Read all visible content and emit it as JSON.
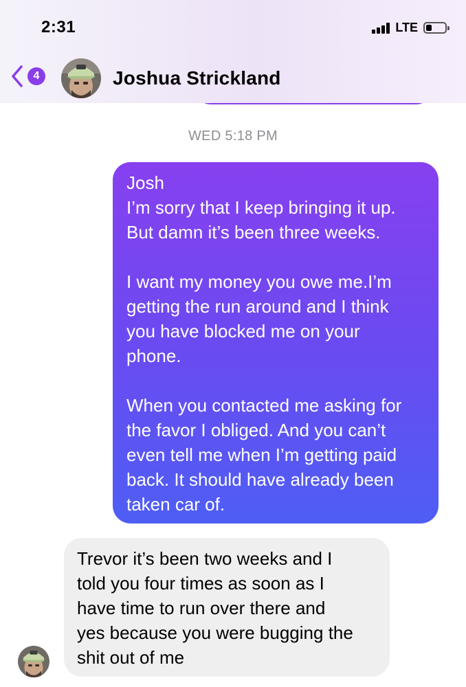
{
  "status_bar": {
    "time": "2:31",
    "network": "LTE",
    "battery_level": 0.3,
    "icons": [
      "signal-icon",
      "battery-icon"
    ]
  },
  "header": {
    "back_badge_count": "4",
    "contact_name": "Joshua Strickland",
    "icons": [
      "chevron-left-icon",
      "avatar"
    ]
  },
  "conversation": {
    "timestamp": "WED 5:18 PM",
    "sent_message": {
      "lines": [
        "Josh",
        "I’m sorry that I keep bringing it up.",
        "But damn it’s been three weeks.",
        "",
        "I want my money you owe me.I’m",
        "getting the run around and I think",
        "you have blocked me on your",
        "phone.",
        "",
        "When you contacted me asking for",
        "the favor I obliged. And you can’t",
        "even tell me when I’m getting paid",
        "back. It should have already been",
        "taken car of."
      ]
    },
    "received_message": {
      "lines": [
        "Trevor it’s been two weeks and I",
        "told you four times as soon as I",
        "have time to run over there and",
        "yes because you were bugging the",
        "shit out of me"
      ]
    }
  },
  "colors": {
    "sent_gradient_top": "#8740ef",
    "sent_gradient_bottom": "#4e5ef4",
    "received_bubble": "#efefef",
    "accent": "#8a3ee8",
    "timestamp": "#8e8e93"
  }
}
